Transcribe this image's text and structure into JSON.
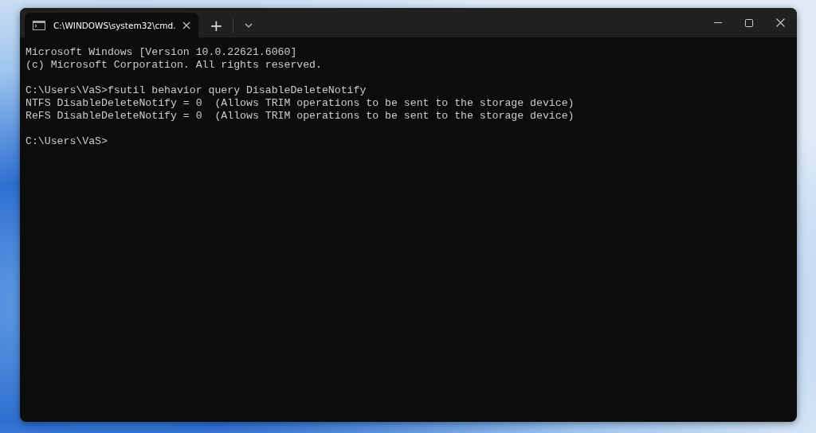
{
  "window": {
    "tabs": [
      {
        "title": "C:\\WINDOWS\\system32\\cmd.",
        "selected": true
      }
    ],
    "new_tab": "+"
  },
  "console": {
    "blocks": [
      [
        "Microsoft Windows [Version 10.0.22621.6060]",
        "(c) Microsoft Corporation. All rights reserved."
      ],
      [
        "C:\\Users\\VaS>fsutil behavior query DisableDeleteNotify",
        "NTFS DisableDeleteNotify = 0  (Allows TRIM operations to be sent to the storage device)",
        "ReFS DisableDeleteNotify = 0  (Allows TRIM operations to be sent to the storage device)"
      ],
      [
        "C:\\Users\\VaS>"
      ]
    ]
  }
}
